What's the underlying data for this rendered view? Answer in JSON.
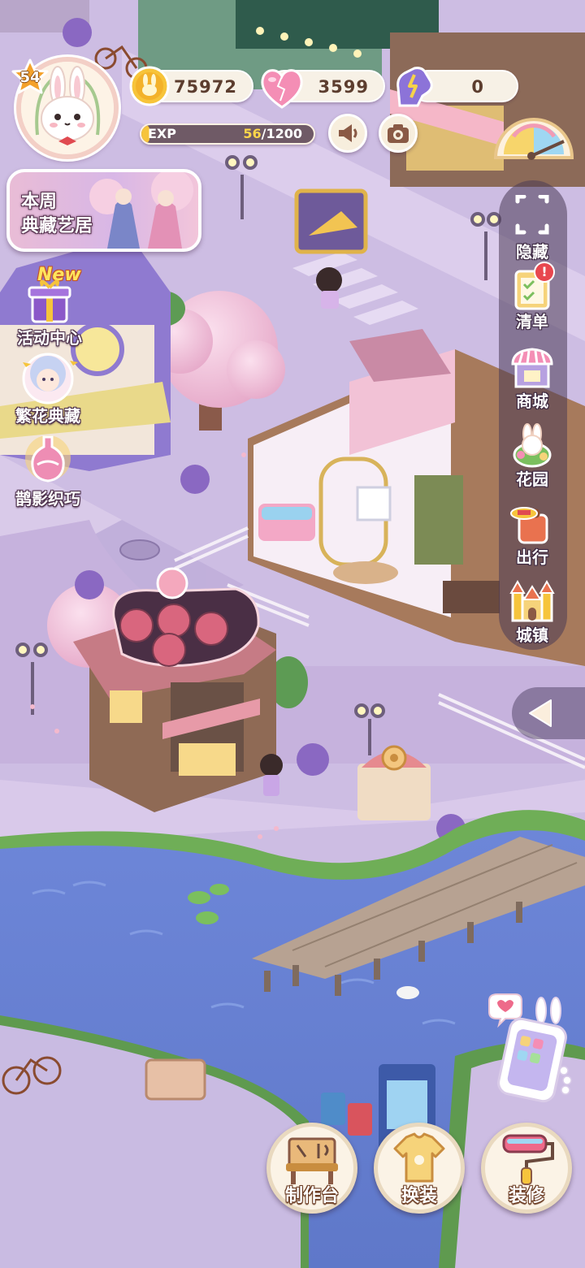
{
  "player": {
    "level": "54",
    "exp_label": "EXP",
    "exp_current": "56",
    "exp_max": "/1200",
    "exp_fraction": 0.047
  },
  "resources": {
    "coins": "75972",
    "hearts": "3599",
    "energy": "0"
  },
  "banner": {
    "weekly_line1": "本周",
    "weekly_line2": "典藏艺居"
  },
  "left_menu": {
    "new_tag": "New",
    "items": [
      {
        "label": "活动中心",
        "icon": "gift-box-icon"
      },
      {
        "label": "繁花典藏",
        "icon": "character-portrait-icon"
      },
      {
        "label": "鹊影织巧",
        "icon": "pink-vase-icon"
      }
    ]
  },
  "right_menu": {
    "alert_badge": "!",
    "items": [
      {
        "label": "隐藏",
        "icon": "hide-frame-icon"
      },
      {
        "label": "清单",
        "icon": "checklist-icon"
      },
      {
        "label": "商城",
        "icon": "shop-icon"
      },
      {
        "label": "花园",
        "icon": "garden-icon"
      },
      {
        "label": "出行",
        "icon": "suitcase-icon"
      },
      {
        "label": "城镇",
        "icon": "castle-icon"
      }
    ]
  },
  "bottom_bar": {
    "workbench": "制作台",
    "outfit": "换装",
    "decorate": "装修"
  },
  "colors": {
    "accent_gold": "#f6c43c",
    "hud_cream": "#f7f1e6",
    "text_brown": "#5c3d2e",
    "water": "#6f87d6",
    "street": "#cfbde2",
    "cherry": "#f0c0d8"
  }
}
